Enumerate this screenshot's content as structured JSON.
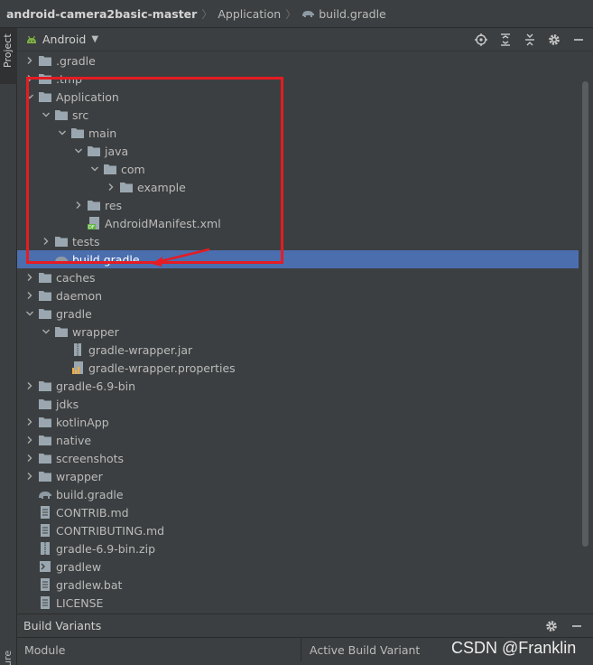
{
  "breadcrumb": {
    "root": "android-camera2basic-master",
    "module": "Application",
    "file": "build.gradle"
  },
  "left_stripe": {
    "project_tab": "Project",
    "structure_tab": "Structure"
  },
  "project_panel": {
    "view_mode": "Android",
    "tool_icons": [
      "locate-icon",
      "expand-all-icon",
      "collapse-all-icon",
      "gear-icon",
      "minimize-icon"
    ]
  },
  "tree": [
    {
      "label": ".gradle",
      "icon": "folder",
      "arrow": "collapsed"
    },
    {
      "label": ".tmp",
      "icon": "folder",
      "arrow": "collapsed"
    },
    {
      "label": "Application",
      "icon": "folder",
      "arrow": "expanded"
    },
    {
      "label": "src",
      "icon": "folder",
      "arrow": "expanded"
    },
    {
      "label": "main",
      "icon": "folder",
      "arrow": "expanded"
    },
    {
      "label": "java",
      "icon": "folder",
      "arrow": "expanded"
    },
    {
      "label": "com",
      "icon": "folder",
      "arrow": "expanded"
    },
    {
      "label": "example",
      "icon": "folder",
      "arrow": "collapsed"
    },
    {
      "label": "res",
      "icon": "folder",
      "arrow": "collapsed"
    },
    {
      "label": "AndroidManifest.xml",
      "icon": "manifest",
      "arrow": "none"
    },
    {
      "label": "tests",
      "icon": "folder",
      "arrow": "collapsed"
    },
    {
      "label": "build.gradle",
      "icon": "gradle",
      "arrow": "none",
      "selected": true
    },
    {
      "label": "caches",
      "icon": "folder",
      "arrow": "collapsed"
    },
    {
      "label": "daemon",
      "icon": "folder",
      "arrow": "collapsed"
    },
    {
      "label": "gradle",
      "icon": "folder",
      "arrow": "expanded"
    },
    {
      "label": "wrapper",
      "icon": "folder",
      "arrow": "expanded"
    },
    {
      "label": "gradle-wrapper.jar",
      "icon": "jar",
      "arrow": "none"
    },
    {
      "label": "gradle-wrapper.properties",
      "icon": "properties",
      "arrow": "none"
    },
    {
      "label": "gradle-6.9-bin",
      "icon": "folder",
      "arrow": "collapsed"
    },
    {
      "label": "jdks",
      "icon": "folder",
      "arrow": "none"
    },
    {
      "label": "kotlinApp",
      "icon": "folder",
      "arrow": "collapsed"
    },
    {
      "label": "native",
      "icon": "folder",
      "arrow": "collapsed"
    },
    {
      "label": "screenshots",
      "icon": "folder",
      "arrow": "collapsed"
    },
    {
      "label": "wrapper",
      "icon": "folder",
      "arrow": "collapsed"
    },
    {
      "label": "build.gradle",
      "icon": "gradle",
      "arrow": "none"
    },
    {
      "label": "CONTRIB.md",
      "icon": "text",
      "arrow": "none"
    },
    {
      "label": "CONTRIBUTING.md",
      "icon": "text",
      "arrow": "none"
    },
    {
      "label": "gradle-6.9-bin.zip",
      "icon": "zip",
      "arrow": "none"
    },
    {
      "label": "gradlew",
      "icon": "terminal",
      "arrow": "none"
    },
    {
      "label": "gradlew.bat",
      "icon": "text",
      "arrow": "none"
    },
    {
      "label": "LICENSE",
      "icon": "text",
      "arrow": "none"
    }
  ],
  "build_variants": {
    "title": "Build Variants",
    "col_module": "Module",
    "col_variant": "Active Build Variant"
  },
  "watermark": "CSDN @Franklin",
  "colors": {
    "background": "#3c3f41",
    "selection": "#4b6eaf",
    "folder": "#9aa7b0",
    "annotation": "#e51c23"
  }
}
